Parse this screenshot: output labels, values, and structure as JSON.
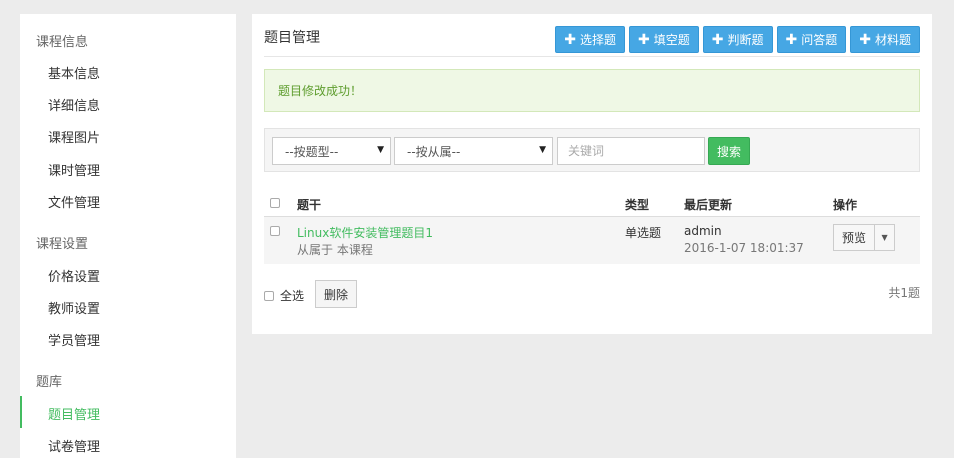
{
  "sidebar": {
    "groups": [
      {
        "label": "课程信息",
        "items": [
          "基本信息",
          "详细信息",
          "课程图片",
          "课时管理",
          "文件管理"
        ]
      },
      {
        "label": "课程设置",
        "items": [
          "价格设置",
          "教师设置",
          "学员管理"
        ]
      },
      {
        "label": "题库",
        "items": [
          "题目管理",
          "试卷管理"
        ]
      }
    ],
    "active_item": "题目管理",
    "accent_color": "#43bc60"
  },
  "panel": {
    "title": "题目管理",
    "add_buttons": [
      "选择题",
      "填空题",
      "判断题",
      "问答题",
      "材料题"
    ],
    "alert": "题目修改成功！"
  },
  "filter": {
    "type_select": "--按题型--",
    "scope_select": "--按从属--",
    "keyword_placeholder": "关键词",
    "search_label": "搜索"
  },
  "table": {
    "headers": {
      "stem": "题干",
      "type": "类型",
      "updated": "最后更新",
      "actions": "操作"
    },
    "rows": [
      {
        "stem": "Linux软件安装管理题目1",
        "belongs": "从属于 本课程",
        "type": "单选题",
        "user": "admin",
        "time": "2016-1-07 18:01:37",
        "action": "预览"
      }
    ]
  },
  "footer": {
    "select_all": "全选",
    "delete_label": "删除",
    "total": "共1题"
  }
}
